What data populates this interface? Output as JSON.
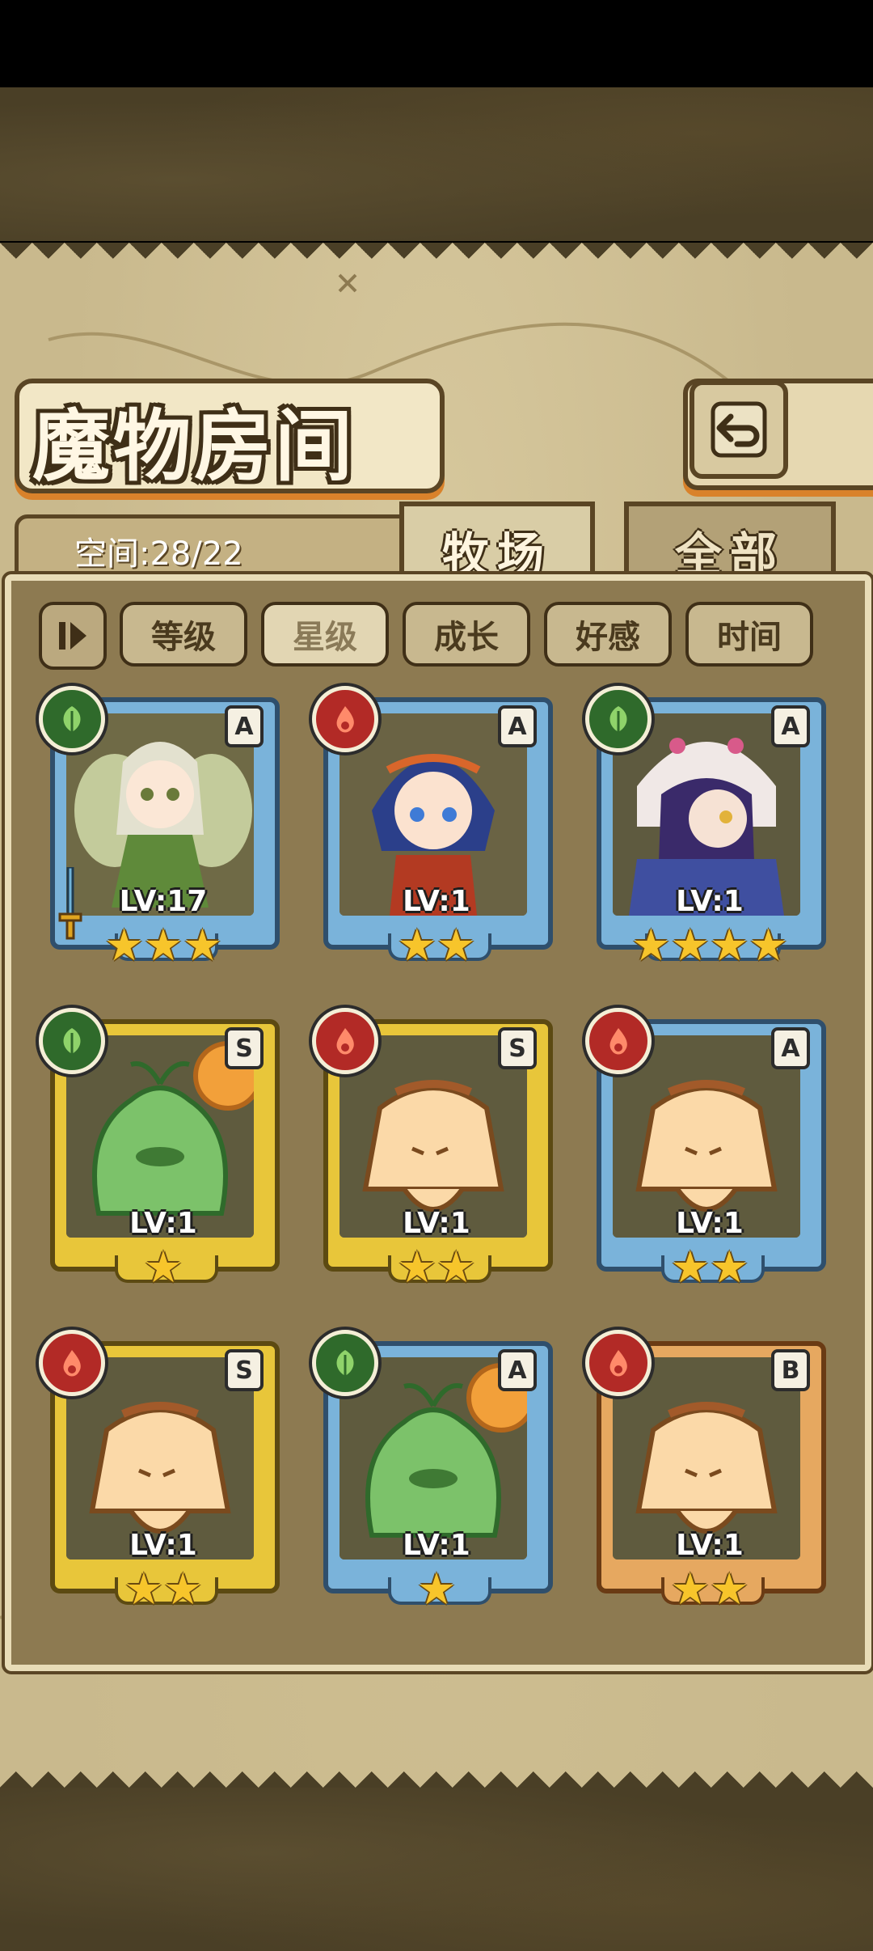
{
  "header": {
    "title": "魔物房间",
    "back_icon": "return-arrow-icon"
  },
  "space": {
    "label": "空间:28/22"
  },
  "tabs": [
    {
      "label": "牧场",
      "active": true
    },
    {
      "label": "全部",
      "active": false
    }
  ],
  "filters": [
    {
      "label": "等级",
      "active": false
    },
    {
      "label": "星级",
      "active": true
    },
    {
      "label": "成长",
      "active": false
    },
    {
      "label": "好感",
      "active": false
    },
    {
      "label": "时间",
      "active": false
    }
  ],
  "cards": [
    {
      "rank": "A",
      "element": "grass",
      "frame": "blue",
      "level": "LV:17",
      "stars": "★★★",
      "star_count": 3,
      "art": "fairy-girl",
      "equip": "sword-icon"
    },
    {
      "rank": "A",
      "element": "fire",
      "frame": "blue",
      "level": "LV:1",
      "stars": "★★",
      "star_count": 2,
      "art": "blue-hair-girl"
    },
    {
      "rank": "A",
      "element": "grass",
      "frame": "blue",
      "level": "LV:1",
      "stars": "★★★★",
      "star_count": 4,
      "art": "hooded-witch"
    },
    {
      "rank": "S",
      "element": "grass",
      "frame": "gold",
      "level": "LV:1",
      "stars": "★",
      "star_count": 1,
      "art": "green-slime"
    },
    {
      "rank": "S",
      "element": "fire",
      "frame": "gold",
      "level": "LV:1",
      "stars": "★★",
      "star_count": 2,
      "art": "pudding-slime"
    },
    {
      "rank": "A",
      "element": "fire",
      "frame": "blue",
      "level": "LV:1",
      "stars": "★★",
      "star_count": 2,
      "art": "pudding-slime"
    },
    {
      "rank": "S",
      "element": "fire",
      "frame": "gold",
      "level": "LV:1",
      "stars": "★★",
      "star_count": 2,
      "art": "pudding-slime"
    },
    {
      "rank": "A",
      "element": "grass",
      "frame": "blue",
      "level": "LV:1",
      "stars": "★",
      "star_count": 1,
      "art": "green-slime"
    },
    {
      "rank": "B",
      "element": "fire",
      "frame": "orange",
      "level": "LV:1",
      "stars": "★★",
      "star_count": 2,
      "art": "pudding-slime"
    }
  ],
  "colors": {
    "parchment": "#c9b98d",
    "frame_blue": "#7ab3da",
    "frame_gold": "#e8c63a",
    "frame_orange": "#e6a860",
    "star": "#f7c52b",
    "element_grass": "#2f6a2b",
    "element_fire": "#b22a26"
  }
}
